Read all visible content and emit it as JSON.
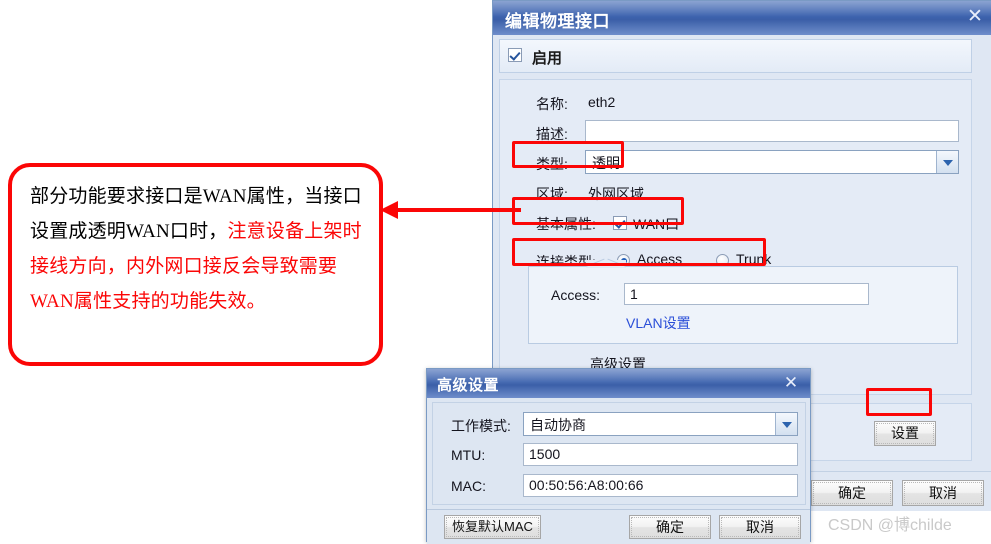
{
  "main_dialog": {
    "title": "编辑物理接口",
    "close_icon": "close-icon",
    "enable_label": "启用",
    "fields": {
      "name_label": "名称:",
      "name_value": "eth2",
      "desc_label": "描述:",
      "desc_value": "",
      "type_label": "类型:",
      "type_value": "透明",
      "zone_label": "区域:",
      "zone_value": "外网区域",
      "basic_attr_label": "基本属性:",
      "wan_label": "WAN口",
      "conn_type_label": "连接类型:",
      "radio_access": "Access",
      "radio_trunk": "Trunk",
      "access_label": "Access:",
      "access_value": "1",
      "vlan_link": "VLAN设置",
      "advanced_label": "高级设置"
    },
    "settings_button": "设置",
    "ok_button": "确定",
    "cancel_button": "取消"
  },
  "adv_dialog": {
    "title": "高级设置",
    "close_icon": "close-icon",
    "workmode_label": "工作模式:",
    "workmode_value": "自动协商",
    "mtu_label": "MTU:",
    "mtu_value": "1500",
    "mac_label": "MAC:",
    "mac_value": "00:50:56:A8:00:66",
    "restore_mac_button": "恢复默认MAC",
    "ok_button": "确定",
    "cancel_button": "取消"
  },
  "callout": {
    "text_black": "部分功能要求接口是WAN属性，当接口设置成透明WAN口时，",
    "text_red": "注意设备上架时接线方向，内外网口接反会导致需要WAN属性支持的功能失效。"
  },
  "watermark": "CSDN @博childe",
  "colors": {
    "highlight_red": "#fb0606",
    "title_blue": "#3d63ae",
    "dialog_bg": "#dfe7f3",
    "link_blue": "#2b4fd8"
  }
}
